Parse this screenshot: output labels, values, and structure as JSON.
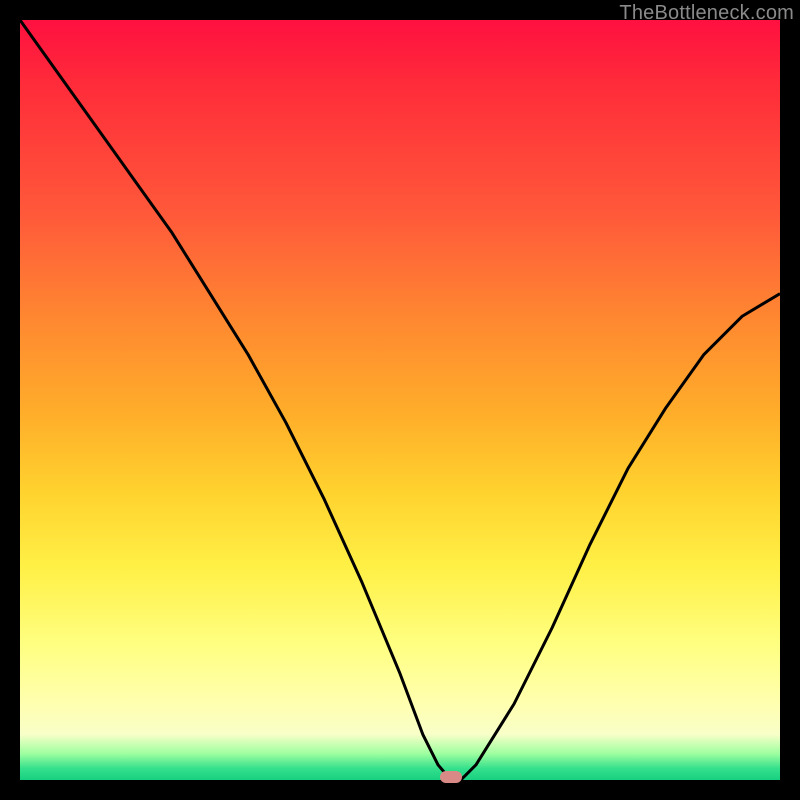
{
  "watermark": {
    "text": "TheBottleneck.com"
  },
  "marker": {
    "color": "#d98a86",
    "x_frac": 0.567,
    "y_frac": 0.996
  },
  "chart_data": {
    "type": "line",
    "title": "",
    "xlabel": "",
    "ylabel": "",
    "xlim": [
      0,
      100
    ],
    "ylim": [
      0,
      100
    ],
    "grid": false,
    "series": [
      {
        "name": "bottleneck-curve",
        "x": [
          0,
          5,
          10,
          15,
          20,
          25,
          30,
          35,
          40,
          45,
          50,
          53,
          55,
          56.7,
          58,
          60,
          65,
          70,
          75,
          80,
          85,
          90,
          95,
          100
        ],
        "y": [
          100,
          93,
          86,
          79,
          72,
          64,
          56,
          47,
          37,
          26,
          14,
          6,
          2,
          0,
          0,
          2,
          10,
          20,
          31,
          41,
          49,
          56,
          61,
          64
        ]
      }
    ],
    "optimum": {
      "x": 56.7,
      "y": 0
    },
    "background_gradient": {
      "orientation": "vertical",
      "stops": [
        {
          "pos": 0.0,
          "color": "#ff1040"
        },
        {
          "pos": 0.26,
          "color": "#ff5a3a"
        },
        {
          "pos": 0.52,
          "color": "#ffae2a"
        },
        {
          "pos": 0.72,
          "color": "#fff046"
        },
        {
          "pos": 0.9,
          "color": "#ffffb0"
        },
        {
          "pos": 0.97,
          "color": "#9fffa0"
        },
        {
          "pos": 1.0,
          "color": "#16d080"
        }
      ]
    }
  }
}
